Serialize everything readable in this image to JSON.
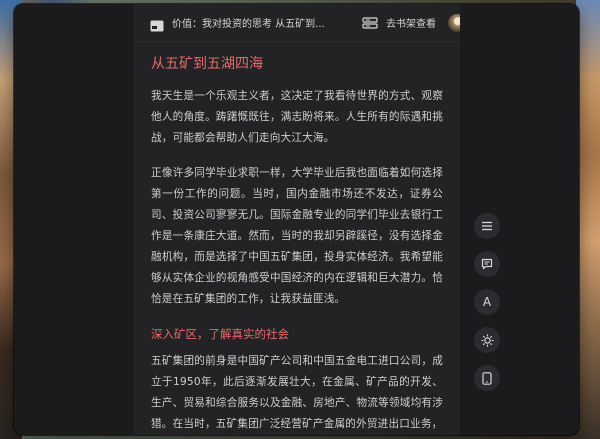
{
  "topbar": {
    "book_title": "价值：我对投资的思考 从五矿到...",
    "shelf_label": "去书架查看"
  },
  "content": {
    "chapter_title": "从五矿到五湖四海",
    "paragraphs": [
      "我天生是一个乐观主义者，这决定了我看待世界的方式、观察他人的角度。踌躇慨既往，满志盼将来。人生所有的际遇和挑战，可能都会帮助人们走向大江大海。",
      "正像许多同学毕业求职一样，大学毕业后我也面临着如何选择第一份工作的问题。当时，国内金融市场还不发达，证券公司、投资公司寥寥无几。国际金融专业的同学们毕业去银行工作是一条康庄大道。然而，当时的我却另辟蹊径，没有选择金融机构，而是选择了中国五矿集团，投身实体经济。我希望能够从实体企业的视角感受中国经济的内在逻辑和巨大潜力。恰恰是在五矿集团的工作，让我获益匪浅。"
    ],
    "section_title": "深入矿区，了解真实的社会",
    "section_paragraphs": [
      "五矿集团的前身是中国矿产公司和中国五金电工进口公司，成立于1950年，此后逐渐发展壮大，在金属、矿产品的开发、生产、贸易和综合服务以及金融、房地产、物流等领域均有涉猎。在当时，五矿集团广泛经营矿产金属的外贸进出口业务，"
    ]
  },
  "side_tools": {
    "font_label": "A"
  },
  "colors": {
    "accent": "#e36b6b",
    "reader_bg": "#232325",
    "window_bg": "#1b1b1d"
  }
}
